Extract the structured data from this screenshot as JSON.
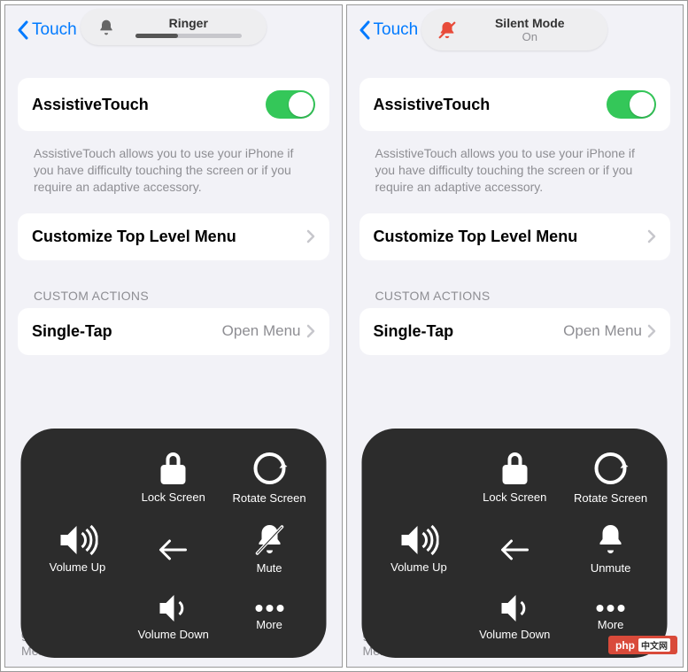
{
  "left": {
    "back": "Touch",
    "hud": {
      "title": "Ringer"
    },
    "setting": {
      "title": "AssistiveTouch"
    },
    "desc": "AssistiveTouch allows you to use your iPhone if you have difficulty touching the screen or if you require an adaptive accessory.",
    "customize": "Customize Top Level Menu",
    "section": "CUSTOM ACTIONS",
    "single_tap": {
      "label": "Single-Tap",
      "value": "Open Menu"
    },
    "footer": "gestures that can be activated from Custom in the Menu.",
    "overlay": {
      "lock": "Lock Screen",
      "rotate": "Rotate Screen",
      "volup": "Volume Up",
      "mute": "Mute",
      "voldown": "Volume Down",
      "more": "More"
    }
  },
  "right": {
    "back": "Touch",
    "hud": {
      "title": "Silent Mode",
      "sub": "On"
    },
    "setting": {
      "title": "AssistiveTouch"
    },
    "desc": "AssistiveTouch allows you to use your iPhone if you have difficulty touching the screen or if you require an adaptive accessory.",
    "customize": "Customize Top Level Menu",
    "section": "CUSTOM ACTIONS",
    "single_tap": {
      "label": "Single-Tap",
      "value": "Open Menu"
    },
    "footer": "gestures that can be activated from Custom in the Menu.",
    "overlay": {
      "lock": "Lock Screen",
      "rotate": "Rotate Screen",
      "volup": "Volume Up",
      "unmute": "Unmute",
      "voldown": "Volume Down",
      "more": "More"
    }
  },
  "badge": "php"
}
